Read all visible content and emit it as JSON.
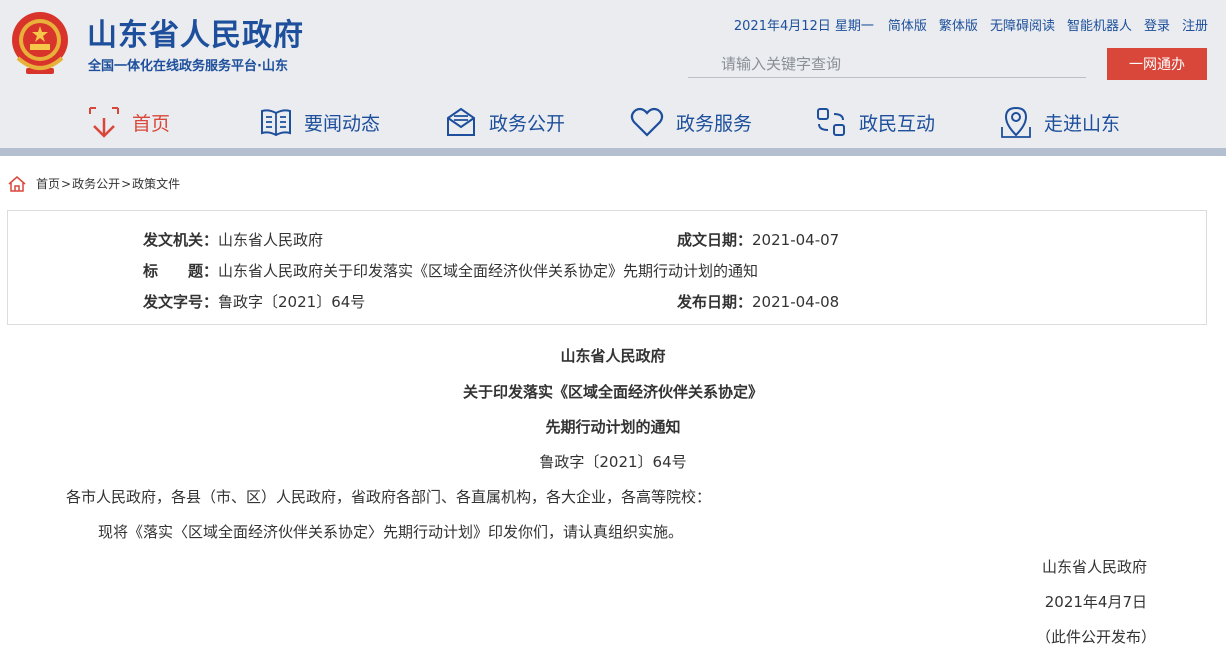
{
  "header": {
    "site_title": "山东省人民政府",
    "site_subtitle": "全国一体化在线政务服务平台·山东",
    "date": "2021年4月12日 星期一",
    "links": [
      "简体版",
      "繁体版",
      "无障碍阅读",
      "智能机器人",
      "登录",
      "注册"
    ],
    "search": {
      "placeholder": "请输入关键字查询",
      "button": "一网通办"
    }
  },
  "nav": {
    "items": [
      {
        "label": "首页",
        "icon": "home-icon"
      },
      {
        "label": "要闻动态",
        "icon": "book-icon"
      },
      {
        "label": "政务公开",
        "icon": "mail-icon"
      },
      {
        "label": "政务服务",
        "icon": "heart-icon"
      },
      {
        "label": "政民互动",
        "icon": "interact-icon"
      },
      {
        "label": "走进山东",
        "icon": "location-icon"
      }
    ]
  },
  "breadcrumb": {
    "items": [
      "首页",
      "政务公开",
      "政策文件"
    ],
    "sep": ">"
  },
  "info": {
    "issuer_label": "发文机关：",
    "issuer": "山东省人民政府",
    "written_date_label": "成文日期：",
    "written_date": "2021-04-07",
    "title_label": "标　　题：",
    "title": "山东省人民政府关于印发落实《区域全面经济伙伴关系协定》先期行动计划的通知",
    "doc_no_label": "发文字号：",
    "doc_no": "鲁政字〔2021〕64号",
    "publish_date_label": "发布日期：",
    "publish_date": "2021-04-08"
  },
  "article": {
    "title_lines": [
      "山东省人民政府",
      "关于印发落实《区域全面经济伙伴关系协定》",
      "先期行动计划的通知"
    ],
    "doc_no": "鲁政字〔2021〕64号",
    "recipients": "各市人民政府，各县（市、区）人民政府，省政府各部门、各直属机构，各大企业，各高等院校：",
    "body": "现将《落实〈区域全面经济伙伴关系协定〉先期行动计划》印发你们，请认真组织实施。",
    "sign_org": "山东省人民政府",
    "sign_date": "2021年4月7日",
    "note": "（此件公开发布）"
  }
}
